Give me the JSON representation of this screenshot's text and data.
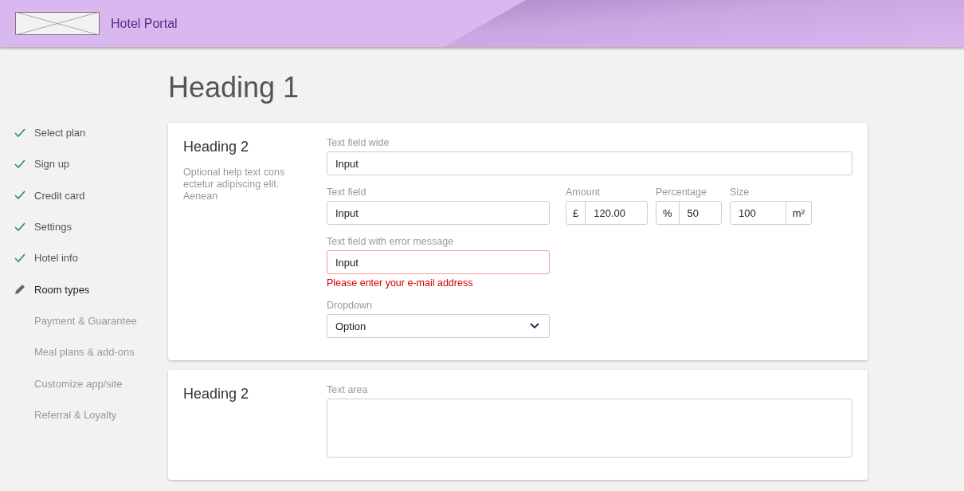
{
  "header": {
    "title": "Hotel Portal"
  },
  "steps": [
    {
      "label": "Select plan",
      "kind": "done"
    },
    {
      "label": "Sign up",
      "kind": "done"
    },
    {
      "label": "Credit card",
      "kind": "done"
    },
    {
      "label": "Settings",
      "kind": "done"
    },
    {
      "label": "Hotel info",
      "kind": "done"
    },
    {
      "label": "Room types",
      "kind": "current"
    },
    {
      "label": "Payment & Guarantee",
      "kind": "pending"
    },
    {
      "label": "Meal plans & add-ons",
      "kind": "pending"
    },
    {
      "label": "Customize app/site",
      "kind": "pending"
    },
    {
      "label": "Referral & Loyalty",
      "kind": "pending"
    }
  ],
  "heading": "Heading 1",
  "sections": [
    {
      "heading": "Heading 2",
      "help": "Optional help text cons ectetur adipiscing elit. Aenean",
      "rows": [
        [
          {
            "kind": "text",
            "label": "Text field wide",
            "value": "Input"
          }
        ],
        [
          {
            "kind": "text",
            "label": "Text field",
            "value": "Input"
          },
          {
            "kind": "prefix",
            "label": "Amount",
            "affix": "£",
            "value": "120.00"
          },
          {
            "kind": "prefix",
            "label": "Percentage",
            "affix": "%",
            "value": "50"
          },
          {
            "kind": "suffix",
            "label": "Size",
            "affix": "m²",
            "value": "100"
          }
        ],
        [
          {
            "kind": "text",
            "label": "Text field with error message",
            "value": "Input",
            "error": "Please enter your e-mail address"
          }
        ],
        [
          {
            "kind": "dropdown",
            "label": "Dropdown",
            "value": "Option"
          }
        ]
      ]
    },
    {
      "heading": "Heading 2",
      "rows": [
        [
          {
            "kind": "textarea",
            "label": "Text area"
          }
        ]
      ]
    }
  ]
}
